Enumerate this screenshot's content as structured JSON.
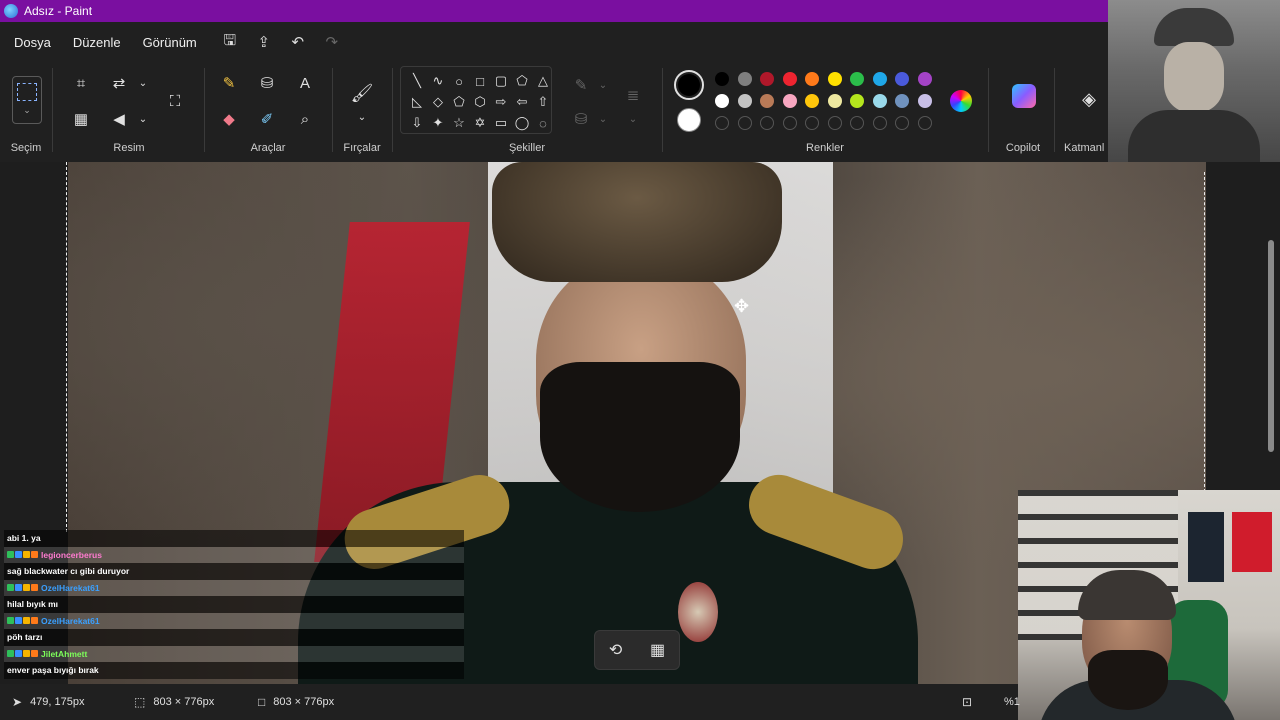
{
  "window": {
    "title": "Adsız - Paint"
  },
  "menu": {
    "file": "Dosya",
    "edit": "Düzenle",
    "view": "Görünüm"
  },
  "ribbon": {
    "groups": {
      "selection": "Seçim",
      "image": "Resim",
      "tools": "Araçlar",
      "brushes": "Fırçalar",
      "shapes": "Şekiller",
      "colors": "Renkler",
      "copilot": "Copilot",
      "layers": "Katmanl"
    },
    "colors": {
      "current": "#000000",
      "secondary": "#ffffff",
      "row1": [
        "#000000",
        "#7f7f7f",
        "#b0182a",
        "#ee2430",
        "#ff7a1a",
        "#ffe000",
        "#2bbd4a",
        "#1fa7e8",
        "#4a5adb",
        "#a443c6"
      ],
      "row2": [
        "#ffffff",
        "#c3c3c3",
        "#b97a57",
        "#f7a6c0",
        "#ffc60b",
        "#eee8a0",
        "#b5e61d",
        "#99d9ea",
        "#7092be",
        "#c8bfe7"
      ]
    }
  },
  "chat": [
    {
      "type": "msg",
      "text": "abi 1. ya"
    },
    {
      "type": "user",
      "name": "legioncerberus",
      "color": "#ff7bd0"
    },
    {
      "type": "msg",
      "text": "sağ blackwater cı gibi duruyor"
    },
    {
      "type": "user",
      "name": "OzelHarekat61",
      "color": "#3aa0ff"
    },
    {
      "type": "msg",
      "text": "hilal bıyık mı"
    },
    {
      "type": "user",
      "name": "OzelHarekat61",
      "color": "#3aa0ff"
    },
    {
      "type": "msg",
      "text": "pöh tarzı"
    },
    {
      "type": "user",
      "name": "JiletAhmett",
      "color": "#7dff5a"
    },
    {
      "type": "msg",
      "text": "enver paşa bıyığı bırak"
    }
  ],
  "status": {
    "cursor_pos": "479, 175px",
    "selection_size": "803 × 776px",
    "canvas_size": "803 × 776px",
    "zoom": "%1"
  }
}
